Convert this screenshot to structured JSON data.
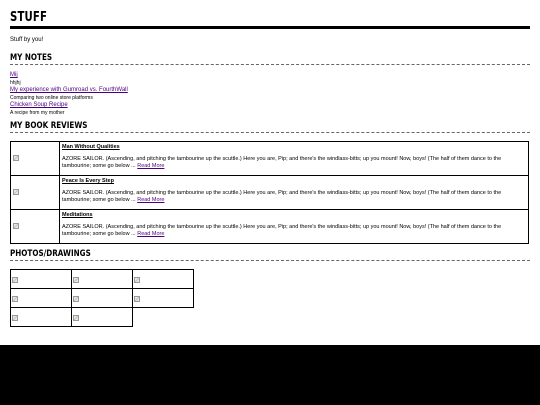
{
  "site": {
    "title": "STUFF",
    "tagline": "Stuff by you!"
  },
  "notes": {
    "heading": "MY NOTES",
    "items": [
      {
        "title": "Mij",
        "desc": "hhjhj"
      },
      {
        "title": "My experience with Gumroad vs. FourthWall",
        "desc": "Comparing two online store platforms"
      },
      {
        "title": "Chicken Soup Recipe",
        "desc": "A recipe from my mother"
      }
    ]
  },
  "reviews": {
    "heading": "MY BOOK REVIEWS",
    "read_more": "Read More",
    "items": [
      {
        "title": "Man Without Qualities",
        "body": "AZORE SAILOR. (Ascending, and pitching the tambourine up the scuttle.) Here you are, Pip; and there's the windlass-bitts; up you mount! Now, boys! (The half of them dance to the tambourine; some go below ..."
      },
      {
        "title": "Peace Is Every Step",
        "body": "AZORE SAILOR. (Ascending, and pitching the tambourine up the scuttle.) Here you are, Pip; and there's the windlass-bitts; up you mount! Now, boys! (The half of them dance to the tambourine; some go below ..."
      },
      {
        "title": "Meditations",
        "body": "AZORE SAILOR. (Ascending, and pitching the tambourine up the scuttle.) Here you are, Pip; and there's the windlass-bitts; up you mount! Now, boys! (The half of them dance to the tambourine; some go below ..."
      }
    ]
  },
  "photos": {
    "heading": "PHOTOS/DRAWINGS",
    "count": 8
  },
  "colors": {
    "link": "#4b0082",
    "footer": "#000000"
  }
}
